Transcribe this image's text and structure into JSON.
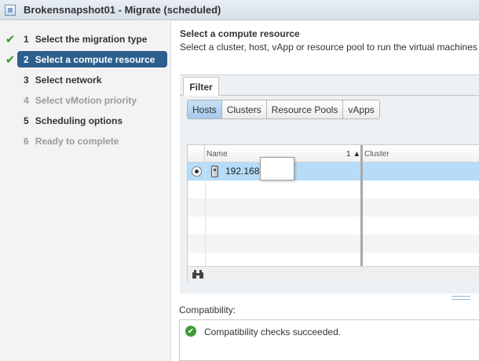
{
  "window": {
    "title": "Brokensnapshot01 - Migrate (scheduled)",
    "title_icon": "vm-icon"
  },
  "steps": [
    {
      "num": "1",
      "label": "Select the migration type",
      "state": "done"
    },
    {
      "num": "2",
      "label": "Select a compute resource",
      "state": "active"
    },
    {
      "num": "3",
      "label": "Select network",
      "state": "enabled"
    },
    {
      "num": "4",
      "label": "Select vMotion priority",
      "state": "disabled"
    },
    {
      "num": "5",
      "label": "Scheduling options",
      "state": "enabled"
    },
    {
      "num": "6",
      "label": "Ready to complete",
      "state": "disabled"
    }
  ],
  "main": {
    "heading": "Select a compute resource",
    "subheading": "Select a cluster, host, vApp or resource pool to run the virtual machines"
  },
  "filter": {
    "tab_label": "Filter",
    "segments": [
      "Hosts",
      "Clusters",
      "Resource Pools",
      "vApps"
    ],
    "selected_segment": "Hosts"
  },
  "grid": {
    "columns": {
      "name": "Name",
      "sort": "1 ▲",
      "cluster": "Cluster"
    },
    "rows": [
      {
        "name": "192.168",
        "cluster": "",
        "selected": true
      }
    ],
    "footer_icon": "binoculars-icon"
  },
  "compatibility": {
    "label": "Compatibility:",
    "message": "Compatibility checks succeeded.",
    "status_icon": "success-check-icon"
  },
  "colors": {
    "active_step": "#2d5f8e",
    "check_green": "#3a9a2e",
    "selected_row": "#b6dcf8",
    "selected_segment": "#a6c9ea"
  }
}
